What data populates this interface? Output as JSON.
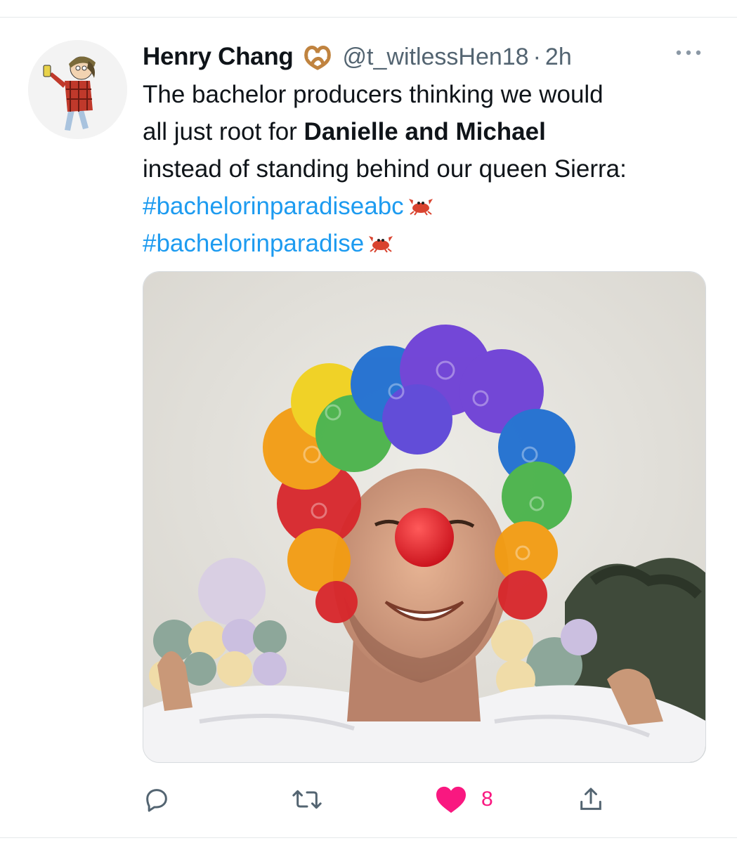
{
  "tweet": {
    "author_name": "Henry Chang",
    "author_handle": "@t_witlessHen18",
    "separator": "·",
    "time": "2h",
    "text_lines": {
      "line1": "The bachelor producers thinking we would",
      "line2_prefix": "all just root for ",
      "line2_bold": "Danielle and Michael",
      "line3": "instead of standing behind our queen Sierra:"
    },
    "hashtags": [
      "#bachelorinparadiseabc",
      "#bachelorinparadise"
    ],
    "media_description_icon": "clown-wig-photo"
  },
  "actions": {
    "reply_icon": "reply-icon",
    "retweet_icon": "retweet-icon",
    "like_icon": "heart-filled-icon",
    "like_count": "8",
    "share_icon": "share-icon"
  },
  "colors": {
    "link": "#1d9bf0",
    "muted": "#536471",
    "like": "#f91880"
  }
}
